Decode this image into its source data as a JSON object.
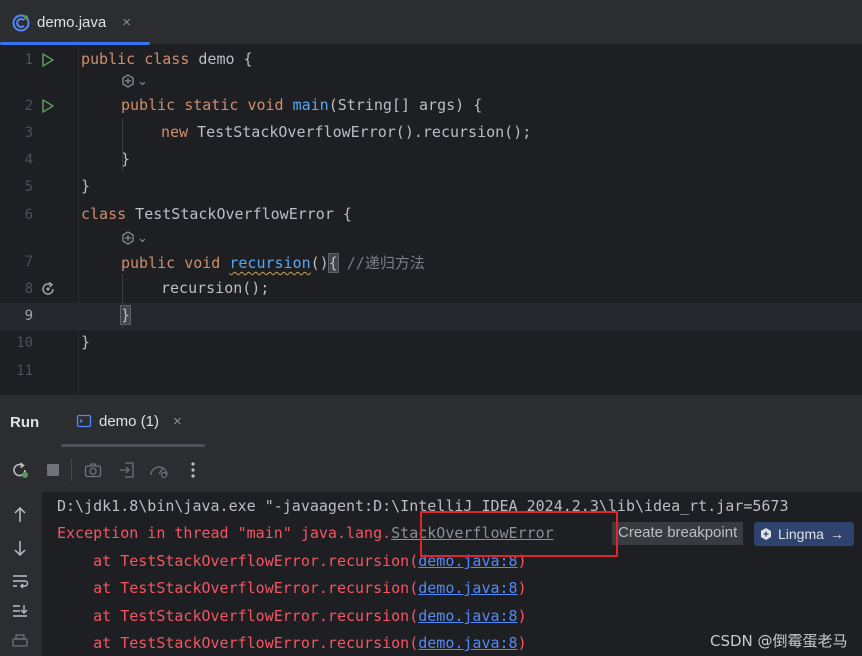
{
  "editor_tab": {
    "label": "demo.java",
    "close": "×"
  },
  "editor": {
    "line_numbers": [
      "1",
      "2",
      "3",
      "4",
      "5",
      "6",
      "7",
      "8",
      "9",
      "10",
      "11"
    ],
    "line1": {
      "kw1": "public",
      "kw2": "class",
      "name": " demo {"
    },
    "line2": {
      "kw1": "public",
      "kw2": "static",
      "kw3": "void",
      "fn": "main",
      "rest": "(String[] args) {"
    },
    "line3": {
      "kw": "new",
      "rest": " TestStackOverflowError().recursion();"
    },
    "line4": "}",
    "line5": "}",
    "line6": {
      "kw": "class",
      "rest": " TestStackOverflowError {"
    },
    "line7": {
      "kw1": "public",
      "kw2": "void",
      "fn": "recursion",
      "paren": "()",
      "brace": "{",
      "comment": " //递归方法"
    },
    "line8": "recursion();",
    "line9": "}",
    "line10": "}",
    "hint_chevron": "⌄"
  },
  "run_panel": {
    "title": "Run",
    "tab_label": "demo (1)",
    "tab_close": "×"
  },
  "console": {
    "command": "D:\\jdk1.8\\bin\\java.exe \"-javaagent:D:\\IntelliJ IDEA 2024.2.3\\lib\\idea_rt.jar=5673",
    "exception_prefix": "Exception in thread \"main\" java.lang.",
    "exception_class": "StackOverflowError",
    "create_breakpoint": "Create breakpoint",
    "lingma": "Lingma",
    "lingma_arrow": "→",
    "trace_prefix": "    at TestStackOverflowError.recursion(",
    "trace_link": "demo.java:8",
    "trace_suffix": ")"
  },
  "watermark": "CSDN @倒霉蛋老马",
  "colors": {
    "accent": "#3574f0",
    "error": "#f75464",
    "link": "#548af7",
    "keyword": "#cf8e6d",
    "function": "#56a8f5"
  }
}
